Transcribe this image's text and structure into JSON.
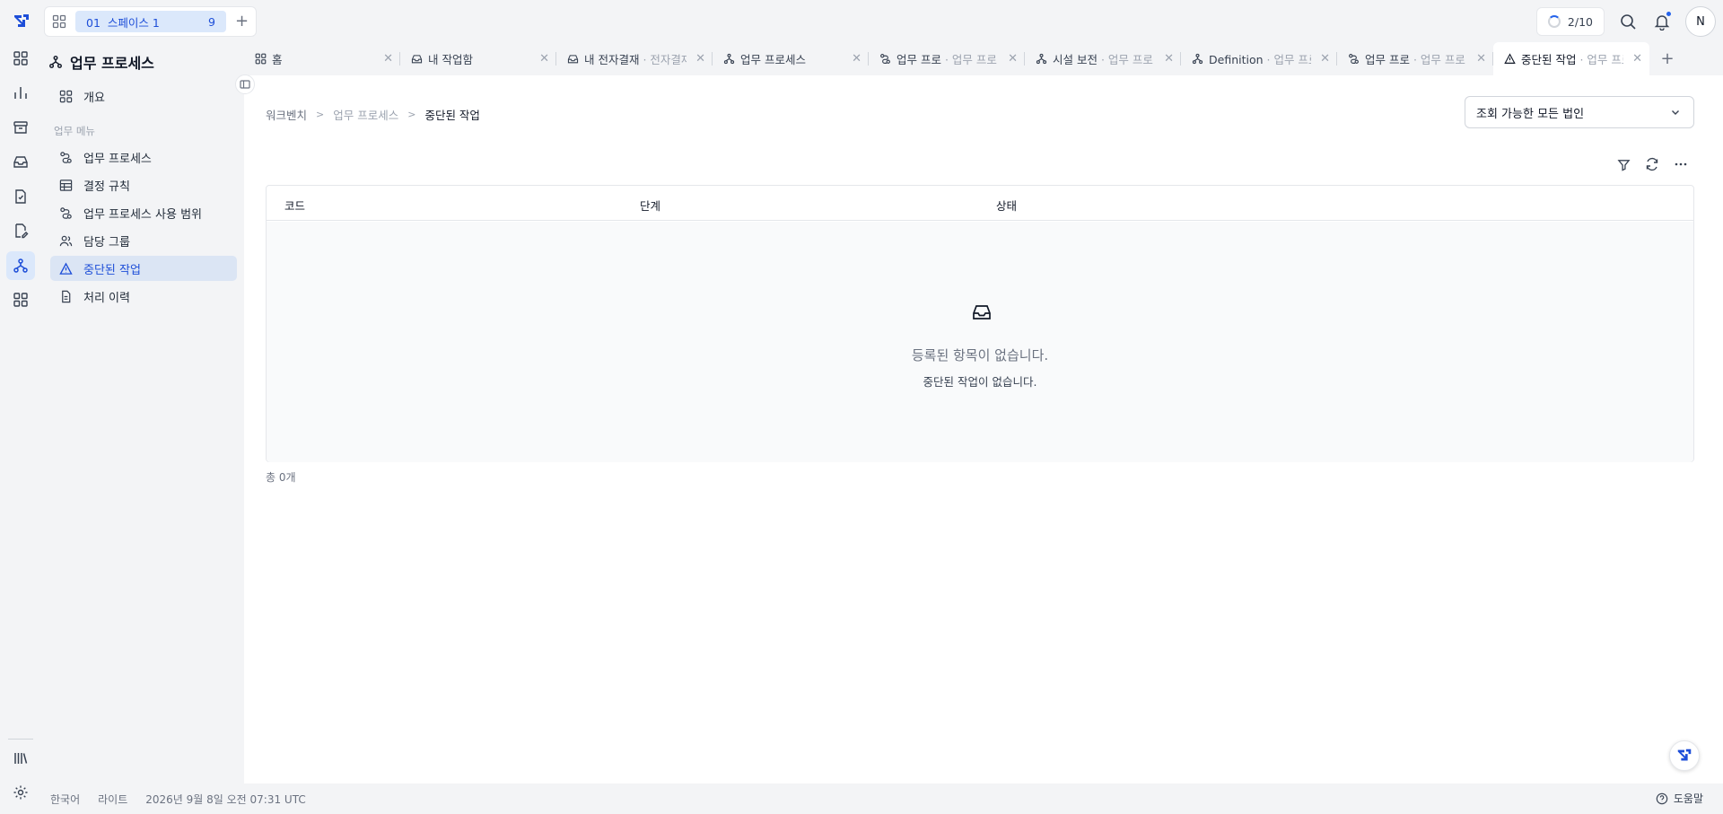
{
  "app": {
    "brand_color": "#1d4ed8"
  },
  "space": {
    "code": "01",
    "name": "스페이스 1",
    "count": "9"
  },
  "top": {
    "progress": "2/10",
    "avatar_initial": "N"
  },
  "sidebar": {
    "title": "업무 프로세스",
    "overview": "개요",
    "section": "업무 메뉴",
    "items": [
      {
        "label": "업무 프로세스",
        "icon": "route-icon"
      },
      {
        "label": "결정 규칙",
        "icon": "table-icon"
      },
      {
        "label": "업무 프로세스 사용 범위",
        "icon": "route-icon"
      },
      {
        "label": "담당 그룹",
        "icon": "users-icon"
      },
      {
        "label": "중단된 작업",
        "icon": "warning-icon"
      },
      {
        "label": "처리 이력",
        "icon": "file-icon"
      }
    ]
  },
  "tabs": [
    {
      "label": "홈",
      "sub": ""
    },
    {
      "label": "내 작업함",
      "sub": ""
    },
    {
      "label": "내 전자결재",
      "sub": " · 전자결재"
    },
    {
      "label": "업무 프로세스",
      "sub": ""
    },
    {
      "label": "업무 프로",
      "sub": " · 업무 프로"
    },
    {
      "label": "시설 보전",
      "sub": " · 업무 프로"
    },
    {
      "label": "Definition",
      "sub": " · 업무 프로"
    },
    {
      "label": "업무 프로",
      "sub": " · 업무 프로"
    },
    {
      "label": "중단된 작업",
      "sub": " · 업무 프로세"
    }
  ],
  "breadcrumb": [
    "워크벤치",
    "업무 프로세스",
    "중단된 작업"
  ],
  "corp_select": {
    "value": "조회 가능한 모든 법인"
  },
  "table": {
    "columns": [
      "코드",
      "단계",
      "상태"
    ],
    "empty_title": "등록된 항목이 없습니다.",
    "empty_sub": "중단된 작업이 없습니다."
  },
  "total": "총 0개",
  "footer": {
    "language": "한국어",
    "theme": "라이트",
    "datetime": "2026년 9월 8일 오전 07:31 UTC",
    "help": "도움말"
  }
}
